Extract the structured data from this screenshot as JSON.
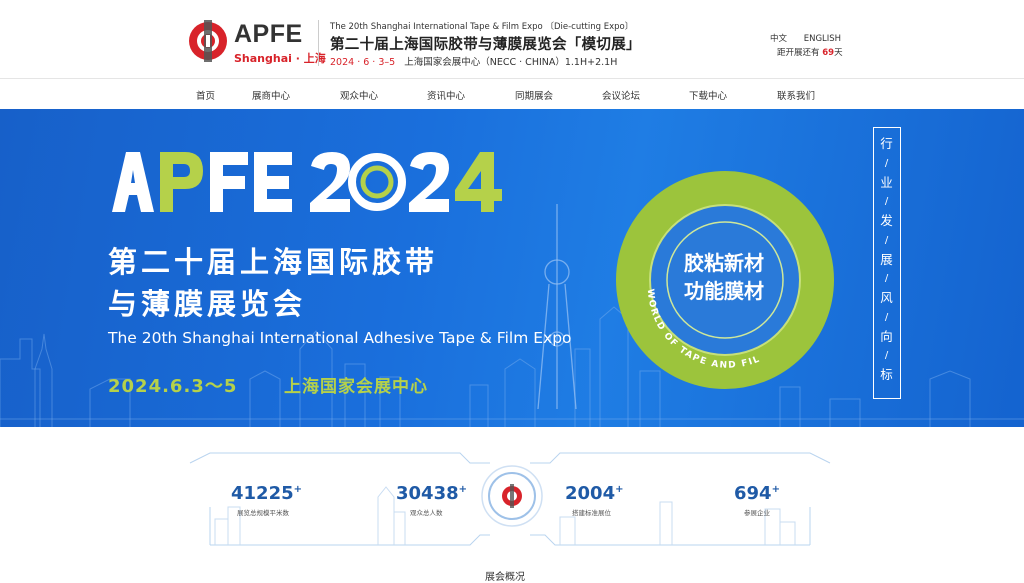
{
  "header": {
    "logo_text": "APFE",
    "logo_sub": "Shanghai · 上海",
    "expo_en": "The 20th Shanghai International Tape & Film Expo 〔Die-cutting Expo〕",
    "expo_cn": "第二十届上海国际胶带与薄膜展览会「模切展」",
    "expo_date": "2024 · 6 · 3–5",
    "expo_venue": "上海国家会展中心（NECC · CHINA）1.1H+2.1H",
    "lang_cn": "中文",
    "lang_en": "ENGLISH",
    "countdown_prefix": "距开展还有",
    "countdown_days": "69",
    "countdown_suffix": "天"
  },
  "nav": {
    "items": [
      {
        "label": "首页"
      },
      {
        "label": "展商中心"
      },
      {
        "label": "观众中心"
      },
      {
        "label": "资讯中心"
      },
      {
        "label": "同期展会"
      },
      {
        "label": "会议论坛"
      },
      {
        "label": "下载中心"
      },
      {
        "label": "联系我们"
      }
    ]
  },
  "banner": {
    "big_title": "APFE 2024",
    "cn_title_line1": "第二十届上海国际胶带",
    "cn_title_line2": "与薄膜展览会",
    "en_title": "The 20th Shanghai International Adhesive Tape & Film Expo",
    "date": "2024.6.3～5",
    "venue": "上海国家会展中心",
    "ring_line1": "胶粘新材",
    "ring_line2": "功能膜材",
    "ring_arc": "WORLD OF TAPE AND FILM",
    "vertical_chars": [
      "行",
      "业",
      "发",
      "展",
      "风",
      "向",
      "标"
    ]
  },
  "stats": {
    "items": [
      {
        "value": "41225",
        "plus": "+",
        "label": "展览总规模平米数"
      },
      {
        "value": "30438",
        "plus": "+",
        "label": "观众总人数"
      },
      {
        "value": "2004",
        "plus": "+",
        "label": "搭建标准展位"
      },
      {
        "value": "694",
        "plus": "+",
        "label": "参展企业"
      }
    ],
    "partial_heading": "展会概况"
  },
  "colors": {
    "brand_red": "#d8232a",
    "banner_blue": "#1a6fdc",
    "accent_green": "#b5d14a",
    "stat_blue": "#1f5aa6"
  }
}
